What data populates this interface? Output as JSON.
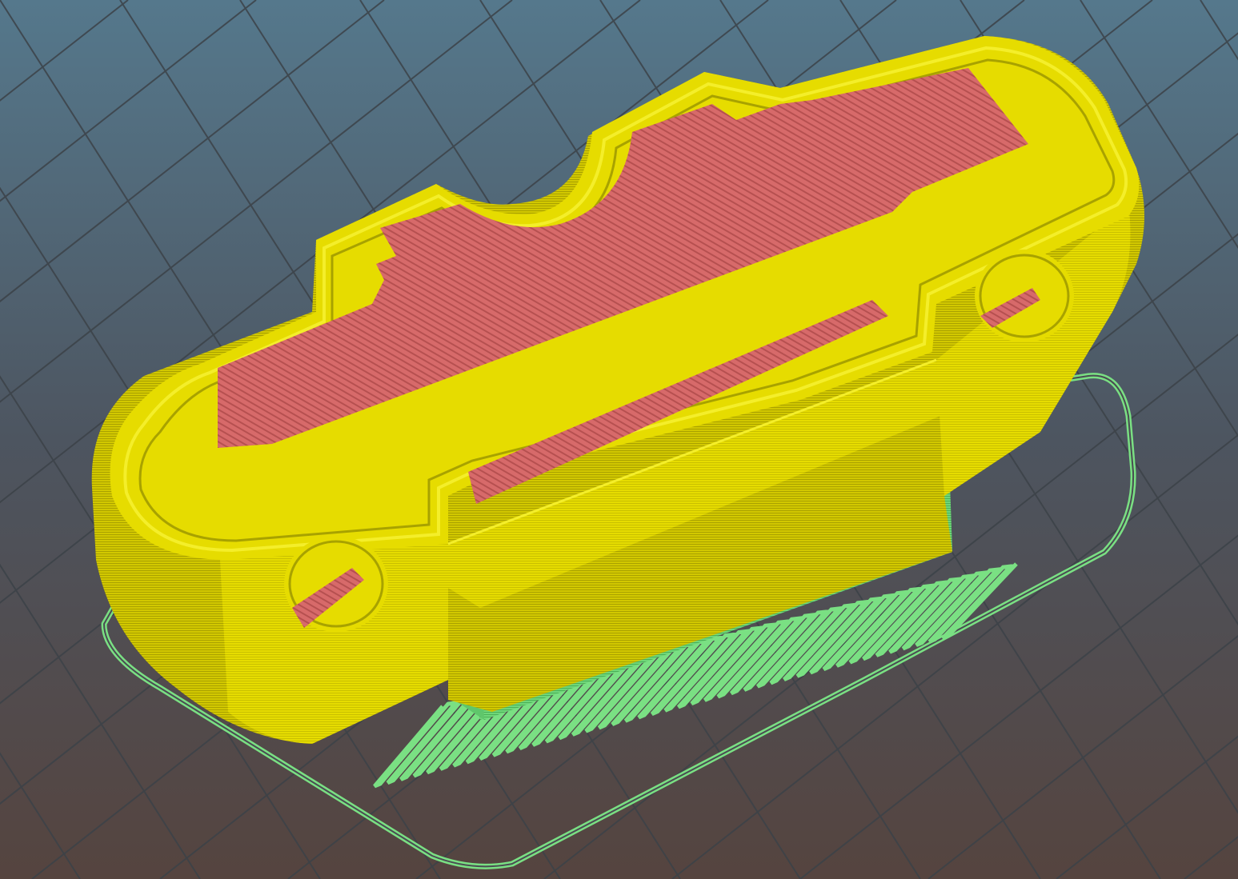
{
  "app": {
    "view": "3d-gcode-preview"
  },
  "colors": {
    "background_top": "#55788c",
    "background_mid": "#4d5560",
    "background_bottom": "#55443f",
    "grid_line": "#3c4248",
    "perimeter": "#e6dc00",
    "perimeter_shadow": "#a8a200",
    "perimeter_highlight": "#f4ee2a",
    "solid_infill": "#d76a6a",
    "solid_infill_stripe": "#b65050",
    "support": "#6fd67a",
    "support_dark": "#4bb057",
    "skirt": "#7ae083"
  },
  "legend": {
    "features": [
      "perimeter",
      "solid-infill",
      "support-material",
      "skirt"
    ]
  }
}
